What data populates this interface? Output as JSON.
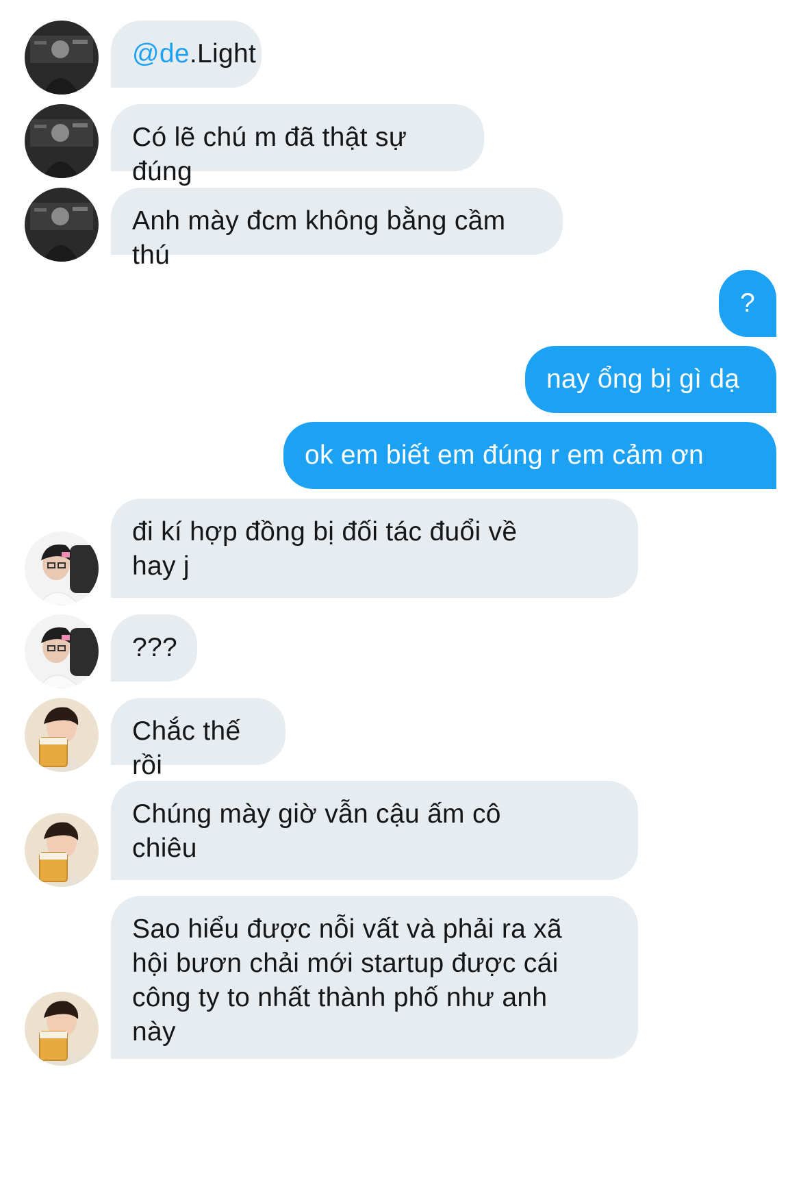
{
  "messages": [
    {
      "side": "in",
      "avatar": "user-a",
      "mention": "@de",
      "text": ".Light"
    },
    {
      "side": "in",
      "avatar": "user-a",
      "text": "Có lẽ chú m đã thật sự đúng"
    },
    {
      "side": "in",
      "avatar": "user-a",
      "text": "Anh mày đcm không bằng cầm thú"
    },
    {
      "side": "out",
      "text": "?"
    },
    {
      "side": "out",
      "text": "nay ổng bị gì dạ"
    },
    {
      "side": "out",
      "text": "ok em biết em đúng r em cảm ơn"
    },
    {
      "side": "in",
      "avatar": "user-b",
      "text": "đi kí hợp đồng bị đối tác đuổi về\nhay j"
    },
    {
      "side": "in",
      "avatar": "user-b",
      "text": "???"
    },
    {
      "side": "in",
      "avatar": "user-c",
      "text": "Chắc thế rồi"
    },
    {
      "side": "in",
      "avatar": "user-c",
      "text": "Chúng mày giờ vẫn cậu ấm cô\nchiêu"
    },
    {
      "side": "in",
      "avatar": "user-c",
      "text": "Sao hiểu được nỗi vất và phải ra xã\nhội bươn chải mới startup được cái\ncông ty to nhất thành phố như anh\nnày"
    }
  ],
  "colors": {
    "incoming_bubble": "#e6ecf0",
    "outgoing_bubble": "#1da1f2",
    "mention": "#1da1f2",
    "text_dark": "#14171a"
  }
}
